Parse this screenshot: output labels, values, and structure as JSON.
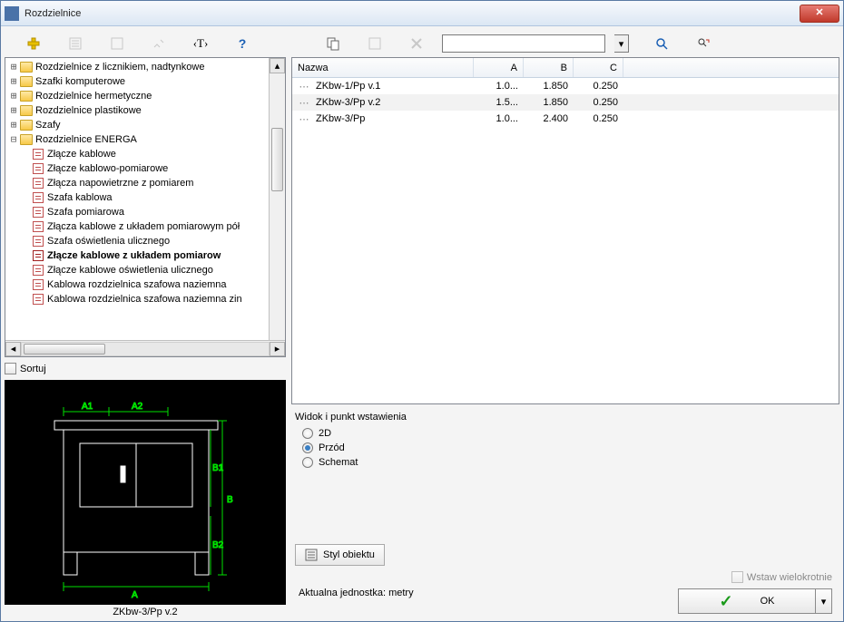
{
  "window": {
    "title": "Rozdzielnice"
  },
  "toolbar": {
    "search_placeholder": ""
  },
  "tree": {
    "top_folders": [
      "Rozdzielnice z licznikiem, nadtynkowe",
      "Szafki komputerowe",
      "Rozdzielnice hermetyczne",
      "Rozdzielnice plastikowe",
      "Szafy"
    ],
    "open_folder": "Rozdzielnice ENERGA",
    "items": [
      "Złącze kablowe",
      "Złącze kablowo-pomiarowe",
      "Złącza napowietrzne z pomiarem",
      "Szafa kablowa",
      "Szafa pomiarowa",
      "Złącza kablowe z układem pomiarowym pół",
      "Szafa oświetlenia ulicznego",
      "Złącze kablowe z układem pomiarow",
      "Złącze kablowe oświetlenia ulicznego",
      "Kablowa rozdzielnica szafowa naziemna",
      "Kablowa rozdzielnica szafowa naziemna zin"
    ],
    "selected_index": 7
  },
  "sort": {
    "label": "Sortuj"
  },
  "preview": {
    "caption": "ZKbw-3/Pp v.2",
    "dims": {
      "A": "A",
      "A1": "A1",
      "A2": "A2",
      "B": "B",
      "B1": "B1",
      "B2": "B2"
    }
  },
  "list": {
    "columns": {
      "name": "Nazwa",
      "a": "A",
      "b": "B",
      "c": "C"
    },
    "rows": [
      {
        "name": "ZKbw-1/Pp v.1",
        "a": "1.0...",
        "b": "1.850",
        "c": "0.250"
      },
      {
        "name": "ZKbw-3/Pp v.2",
        "a": "1.5...",
        "b": "1.850",
        "c": "0.250",
        "selected": true
      },
      {
        "name": "ZKbw-3/Pp",
        "a": "1.0...",
        "b": "2.400",
        "c": "0.250"
      }
    ]
  },
  "options": {
    "title": "Widok i punkt wstawienia",
    "radios": [
      {
        "label": "2D",
        "checked": false
      },
      {
        "label": "Przód",
        "checked": true
      },
      {
        "label": "Schemat",
        "checked": false
      }
    ],
    "style_button": "Styl obiektu",
    "unit_label": "Aktualna jednostka: metry",
    "insert_multi": "Wstaw wielokrotnie",
    "ok": "OK"
  }
}
